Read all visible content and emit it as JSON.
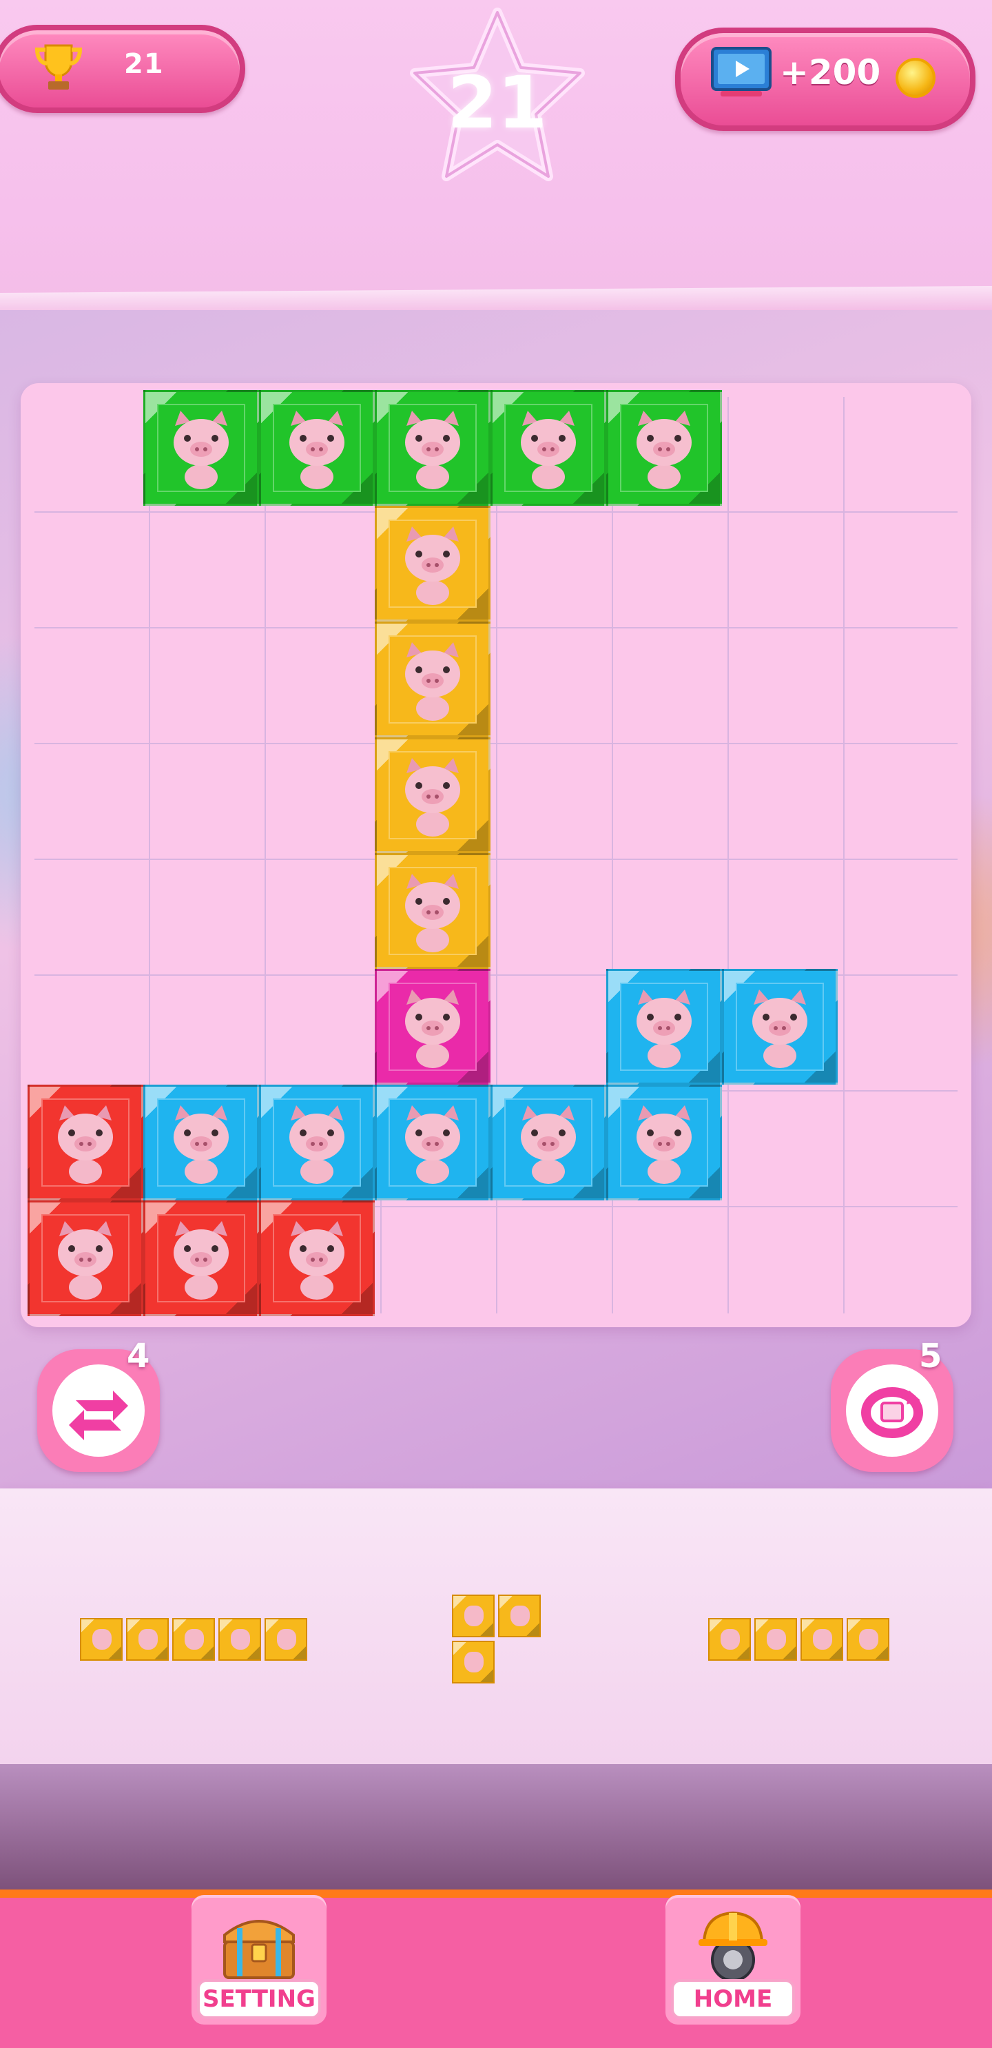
{
  "hud": {
    "best_score": "21",
    "current_score": "21",
    "reward_label": "+200",
    "icons": {
      "best": "trophy-icon",
      "reward": "video-ad-icon",
      "coin": "coin-icon",
      "score_badge": "star-icon"
    }
  },
  "board": {
    "rows": 8,
    "cols": 8,
    "cells": [
      [
        "",
        "green",
        "green",
        "green",
        "green",
        "green",
        "",
        ""
      ],
      [
        "",
        "",
        "",
        "yellow",
        "",
        "",
        "",
        ""
      ],
      [
        "",
        "",
        "",
        "yellow",
        "",
        "",
        "",
        ""
      ],
      [
        "",
        "",
        "",
        "yellow",
        "",
        "",
        "",
        ""
      ],
      [
        "",
        "",
        "",
        "yellow",
        "",
        "",
        "",
        ""
      ],
      [
        "",
        "",
        "",
        "magenta",
        "",
        "cyan",
        "cyan",
        ""
      ],
      [
        "red",
        "cyan",
        "cyan",
        "cyan",
        "cyan",
        "cyan",
        "",
        ""
      ],
      [
        "red",
        "red",
        "red",
        "",
        "",
        "",
        "",
        ""
      ]
    ],
    "colors": {
      "green": "#21c42a",
      "yellow": "#f7b81b",
      "magenta": "#ea2aa9",
      "cyan": "#1fb4ef",
      "red": "#f2352f"
    }
  },
  "powerups": {
    "shuffle": {
      "count": "4",
      "icon": "shuffle-icon"
    },
    "rotate": {
      "count": "5",
      "icon": "rotate-icon"
    }
  },
  "tray": {
    "pieces": [
      {
        "color": "yellow",
        "cells": [
          [
            0,
            0
          ],
          [
            0,
            1
          ],
          [
            0,
            2
          ],
          [
            0,
            3
          ],
          [
            0,
            4
          ]
        ]
      },
      {
        "color": "yellow",
        "cells": [
          [
            0,
            0
          ],
          [
            0,
            1
          ],
          [
            1,
            0
          ]
        ]
      },
      {
        "color": "yellow",
        "cells": [
          [
            0,
            0
          ],
          [
            0,
            1
          ],
          [
            0,
            2
          ],
          [
            0,
            3
          ]
        ]
      }
    ]
  },
  "footer": {
    "setting_label": "SETTING",
    "home_label": "HOME",
    "icons": {
      "setting": "treasure-chest-icon",
      "home": "hard-hat-icon"
    }
  }
}
